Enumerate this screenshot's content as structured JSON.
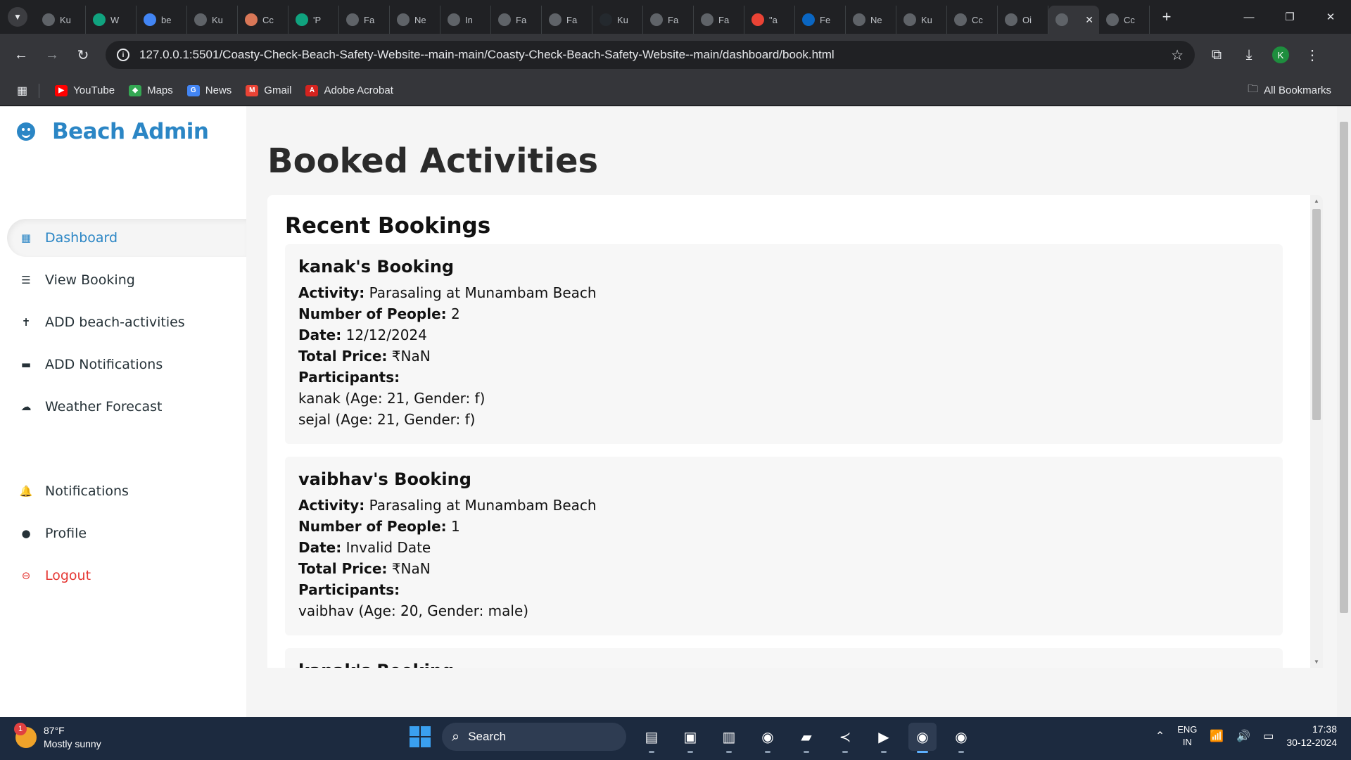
{
  "browser": {
    "tabs": [
      {
        "label": "Ku",
        "icon": "globe-icon",
        "color": "#5f6368"
      },
      {
        "label": "W",
        "icon": "chatgpt-icon",
        "color": "#10a37f"
      },
      {
        "label": "be",
        "icon": "google-icon",
        "color": "#4285f4"
      },
      {
        "label": "Ku",
        "icon": "globe-icon",
        "color": "#5f6368"
      },
      {
        "label": "Cc",
        "icon": "claude-icon",
        "color": "#d97757"
      },
      {
        "label": "'P",
        "icon": "chatgpt-icon",
        "color": "#10a37f"
      },
      {
        "label": "Fa",
        "icon": "globe-icon",
        "color": "#5f6368"
      },
      {
        "label": "Ne",
        "icon": "openai-icon",
        "color": "#5f6368"
      },
      {
        "label": "In",
        "icon": "globe-icon",
        "color": "#5f6368"
      },
      {
        "label": "Fa",
        "icon": "globe-icon",
        "color": "#5f6368"
      },
      {
        "label": "Fa",
        "icon": "globe-icon",
        "color": "#5f6368"
      },
      {
        "label": "Ku",
        "icon": "github-icon",
        "color": "#24292e"
      },
      {
        "label": "Fa",
        "icon": "globe-icon",
        "color": "#5f6368"
      },
      {
        "label": "Fa",
        "icon": "globe-icon",
        "color": "#5f6368"
      },
      {
        "label": "\"a",
        "icon": "gmail-icon",
        "color": "#ea4335"
      },
      {
        "label": "Fe",
        "icon": "linkedin-icon",
        "color": "#0a66c2"
      },
      {
        "label": "Ne",
        "icon": "copilot-icon",
        "color": "#5f6368"
      },
      {
        "label": "Ku",
        "icon": "globe-icon",
        "color": "#5f6368"
      },
      {
        "label": "Cc",
        "icon": "globe-icon",
        "color": "#5f6368"
      },
      {
        "label": "Oi",
        "icon": "globe-icon",
        "color": "#5f6368"
      }
    ],
    "active_tab_icon": "globe-icon",
    "last_tab": {
      "label": "Cc",
      "icon": "globe-icon"
    },
    "url": "127.0.0.1:5501/Coasty-Check-Beach-Safety-Website--main-main/Coasty-Check-Beach-Safety-Website--main/dashboard/book.html",
    "profile_initial": "K",
    "bookmarks": [
      {
        "label": "YouTube",
        "icon": "youtube-icon",
        "color": "#ff0000",
        "glyph": "▶"
      },
      {
        "label": "Maps",
        "icon": "maps-icon",
        "color": "#34a853",
        "glyph": "◆"
      },
      {
        "label": "News",
        "icon": "news-icon",
        "color": "#4285f4",
        "glyph": "G"
      },
      {
        "label": "Gmail",
        "icon": "gmail-icon",
        "color": "#ea4335",
        "glyph": "M"
      },
      {
        "label": "Adobe Acrobat",
        "icon": "acrobat-icon",
        "color": "#d4231f",
        "glyph": "A"
      }
    ],
    "all_bookmarks": "All Bookmarks"
  },
  "sidebar": {
    "brand": "Beach Admin",
    "items": [
      {
        "label": "Dashboard",
        "icon": "dashboard-icon",
        "glyph": "▦",
        "active": true
      },
      {
        "label": "View Booking",
        "icon": "list-icon",
        "glyph": "☰"
      },
      {
        "label": "ADD beach-activities",
        "icon": "person-icon",
        "glyph": "✝"
      },
      {
        "label": "ADD Notifications",
        "icon": "comment-icon",
        "glyph": "▬"
      },
      {
        "label": "Weather Forecast",
        "icon": "cloud-icon",
        "glyph": "☁"
      }
    ],
    "bottom_items": [
      {
        "label": "Notifications",
        "icon": "bell-icon",
        "glyph": "🔔"
      },
      {
        "label": "Profile",
        "icon": "user-circle-icon",
        "glyph": "●"
      },
      {
        "label": "Logout",
        "icon": "logout-icon",
        "glyph": "⊖",
        "logout": true
      }
    ]
  },
  "main": {
    "title": "Booked Activities",
    "section_title": "Recent Bookings",
    "labels": {
      "activity": "Activity:",
      "people": "Number of People:",
      "date": "Date:",
      "price": "Total Price:",
      "participants": "Participants:"
    },
    "bookings": [
      {
        "title": "kanak's Booking",
        "activity": "Parasaling at Munambam Beach",
        "people": "2",
        "date": "12/12/2024",
        "price": "₹NaN",
        "participants": [
          "kanak (Age: 21, Gender: f)",
          "sejal (Age: 21, Gender: f)"
        ]
      },
      {
        "title": "vaibhav's Booking",
        "activity": "Parasaling at Munambam Beach",
        "people": "1",
        "date": "Invalid Date",
        "price": "₹NaN",
        "participants": [
          "vaibhav (Age: 20, Gender: male)"
        ]
      },
      {
        "title": "kanak's Booking",
        "activity": "",
        "people": "",
        "date": "",
        "price": "",
        "participants": []
      }
    ]
  },
  "taskbar": {
    "weather_temp": "87°F",
    "weather_desc": "Mostly sunny",
    "weather_badge": "1",
    "search_label": "Search",
    "lang_top": "ENG",
    "lang_bottom": "IN",
    "time": "17:38",
    "date": "30-12-2024",
    "apps": [
      {
        "icon": "file-explorer-widget-icon",
        "glyph": "▤"
      },
      {
        "icon": "task-view-icon",
        "glyph": "▣"
      },
      {
        "icon": "notepad-icon",
        "glyph": "▥"
      },
      {
        "icon": "chrome-icon",
        "glyph": "◉"
      },
      {
        "icon": "folder-icon",
        "glyph": "▰"
      },
      {
        "icon": "vscode-icon",
        "glyph": "≺"
      },
      {
        "icon": "youtube-icon",
        "glyph": "▶"
      },
      {
        "icon": "chrome-icon",
        "glyph": "◉",
        "active": true
      },
      {
        "icon": "chrome-icon",
        "glyph": "◉"
      }
    ]
  }
}
